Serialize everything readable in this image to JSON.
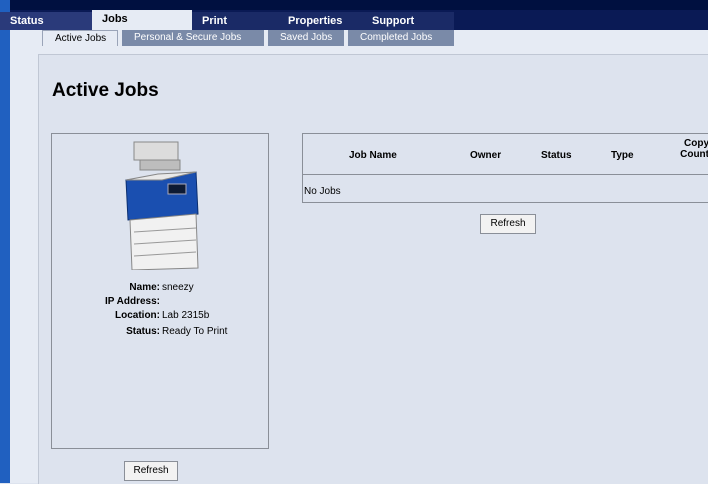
{
  "top_tabs": [
    {
      "label": "Status"
    },
    {
      "label": "Jobs"
    },
    {
      "label": "Print"
    },
    {
      "label": "Properties"
    },
    {
      "label": "Support"
    }
  ],
  "sub_tabs": [
    {
      "label": "Active Jobs"
    },
    {
      "label": "Personal & Secure Jobs"
    },
    {
      "label": "Saved Jobs"
    },
    {
      "label": "Completed Jobs"
    }
  ],
  "page": {
    "title": "Active Jobs"
  },
  "printer": {
    "name_label": "Name:",
    "name": "sneezy",
    "ip_label": "IP Address:",
    "ip": "",
    "location_label": "Location:",
    "location": "Lab 2315b",
    "status_label": "Status:",
    "status": "Ready To Print",
    "refresh_label": "Refresh"
  },
  "jobs_table": {
    "columns": [
      "Job Name",
      "Owner",
      "Status",
      "Type",
      "Copy\nCount"
    ],
    "empty_text": "No Jobs",
    "refresh_label": "Refresh"
  }
}
